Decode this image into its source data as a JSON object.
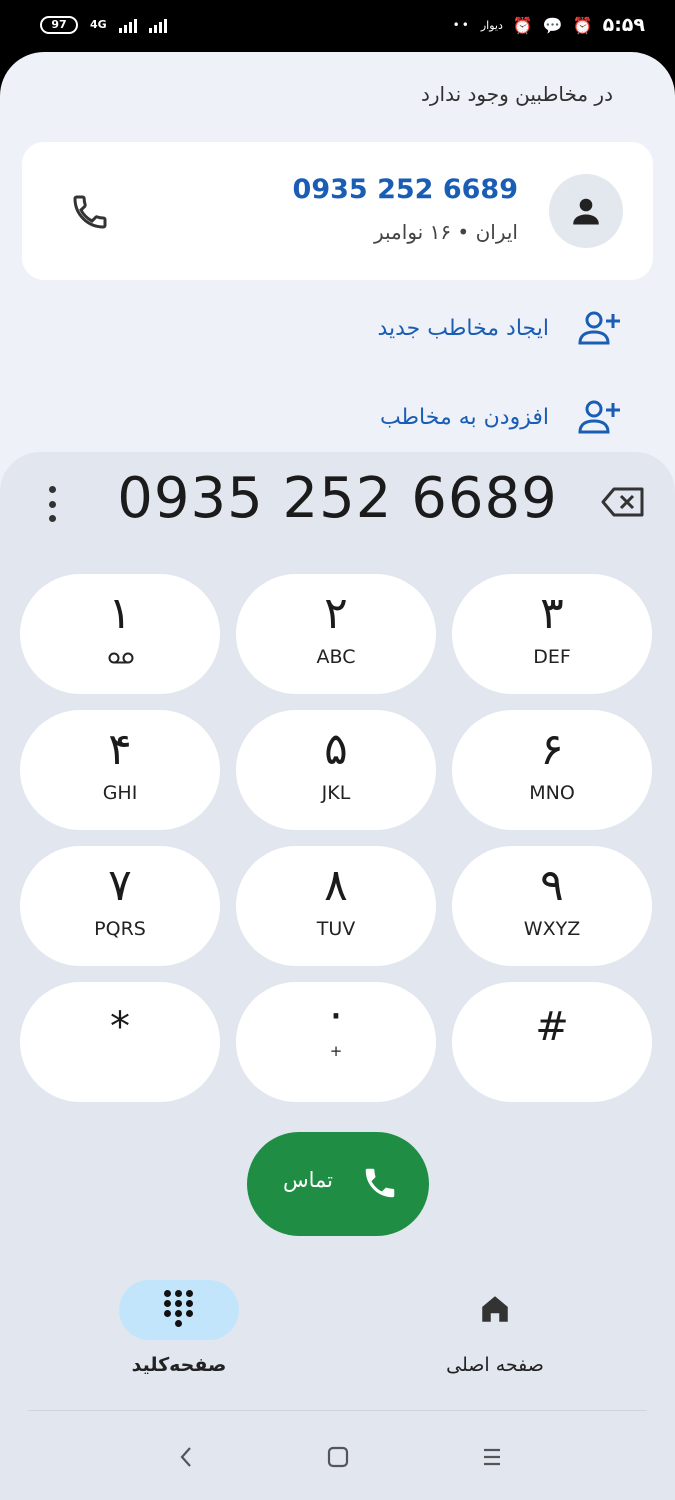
{
  "status_bar": {
    "battery": "97",
    "network": "4G",
    "app_label": "دیوار",
    "time": "۵:۵۹"
  },
  "header": {
    "no_contacts": "در مخاطبین وجود ندارد"
  },
  "result": {
    "number": "0935 252 6689",
    "meta": "ایران • ۱۶ نوامبر"
  },
  "actions": {
    "create_contact": "ایجاد مخاطب جدید",
    "add_to_contact": "افزودن به مخاطب"
  },
  "dialpad": {
    "entered_number": "0935 252 6689",
    "keys": [
      {
        "digit": "۱",
        "letters": ""
      },
      {
        "digit": "۲",
        "letters": "ABC"
      },
      {
        "digit": "۳",
        "letters": "DEF"
      },
      {
        "digit": "۴",
        "letters": "GHI"
      },
      {
        "digit": "۵",
        "letters": "JKL"
      },
      {
        "digit": "۶",
        "letters": "MNO"
      },
      {
        "digit": "۷",
        "letters": "PQRS"
      },
      {
        "digit": "۸",
        "letters": "TUV"
      },
      {
        "digit": "۹",
        "letters": "WXYZ"
      },
      {
        "digit": "*",
        "letters": ""
      },
      {
        "digit": "۰",
        "letters": "+"
      },
      {
        "digit": "#",
        "letters": ""
      }
    ],
    "call_label": "تماس"
  },
  "bottom_nav": {
    "keypad": "صفحه‌کلید",
    "home": "صفحه اصلی"
  },
  "colors": {
    "accent_blue": "#1a5db5",
    "call_green": "#1f8d43",
    "active_tab": "#c3e5fb"
  }
}
